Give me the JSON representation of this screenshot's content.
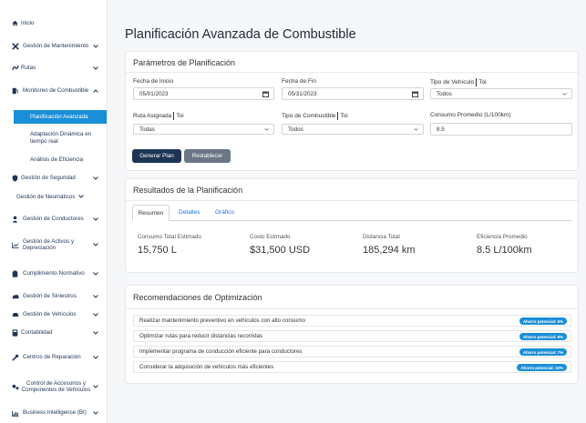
{
  "sidebar": {
    "inicio": "Inicio",
    "gestion_mantenimiento": "Gestión de Mantenimiento",
    "rutas": "Rutas",
    "monitoreo_combustible": "Monitoreo de Combustible",
    "planificacion_avanzada": "Planificación Avanzada",
    "adaptacion_dinamica": "Adaptación Dinámica en tiempo real",
    "analisis_eficiencia": "Análisis de Eficiencia",
    "gestion_seguridad": "Gestión de Seguridad",
    "gestion_neumaticos": "Gestión de Neumáticos",
    "gestion_conductores": "Gestión de Conductores",
    "gestion_activos": "Gestión de Activos y Depreciación",
    "cumplimiento_normativo": "Cumplimiento Normativo",
    "gestion_siniestros": "Gestión de Siniestros",
    "gestion_vehiculos": "Gestión de Vehículos",
    "contabilidad": "Contabilidad",
    "centros_reparacion": "Centros de Reparación",
    "control_accesorios": "Control de Accesorios y Componentes de Vehículos",
    "business_intelligence": "Business Intelligence (BI)"
  },
  "main": {
    "title": "Planificación Avanzada de Combustible"
  },
  "params": {
    "title": "Parámetros de Planificación",
    "fecha_inicio_label": "Fecha de Inicio",
    "fecha_inicio_value": "05/01/2023",
    "fecha_fin_label": "Fecha de Fin",
    "fecha_fin_value": "05/31/2023",
    "tipo_vehiculo_label": "Tipo de Vehículo",
    "tipo_vehiculo_suffix": "Toi",
    "tipo_vehiculo_value": "Todos",
    "ruta_label": "Ruta Asignada",
    "ruta_suffix": "Toi",
    "ruta_value": "Todas",
    "tipo_combustible_label": "Tipo de Combustible",
    "tipo_combustible_suffix": "Toi",
    "tipo_combustible_value": "Todos",
    "consumo_label": "Consumo Promedio (L/100km)",
    "consumo_value": "8.5",
    "generar_button": "Generar Plan",
    "restablecer_button": "Restablecer"
  },
  "results": {
    "title": "Resultados de la Planificación",
    "tabs": [
      "Resumen",
      "Detalles",
      "Gráfico"
    ],
    "stats": [
      {
        "label": "Consumo Total Estimado",
        "value": "15,750 L"
      },
      {
        "label": "Costo Estimado",
        "value": "$31,500 USD"
      },
      {
        "label": "Distancia Total",
        "value": "185,294 km"
      },
      {
        "label": "Eficiencia Promedio",
        "value": "8.5 L/100km"
      }
    ]
  },
  "recommendations": {
    "title": "Recomendaciones de Optimización",
    "items": [
      {
        "text": "Realizar mantenimiento preventivo en vehículos con alto consumo",
        "badge": "Ahorro potencial: 5%"
      },
      {
        "text": "Optimizar rutas para reducir distancias recorridas",
        "badge": "Ahorro potencial: 8%"
      },
      {
        "text": "Implementar programa de conducción eficiente para conductores",
        "badge": "Ahorro potencial: 7%"
      },
      {
        "text": "Considerar la adquisición de vehículos más eficientes",
        "badge": "Ahorro potencial: 10%"
      }
    ]
  },
  "colors": {
    "primary_dark": "#1e3556",
    "accent_blue": "#1a8fd8",
    "link_blue": "#1a73e8",
    "secondary_button": "#6b7785"
  }
}
